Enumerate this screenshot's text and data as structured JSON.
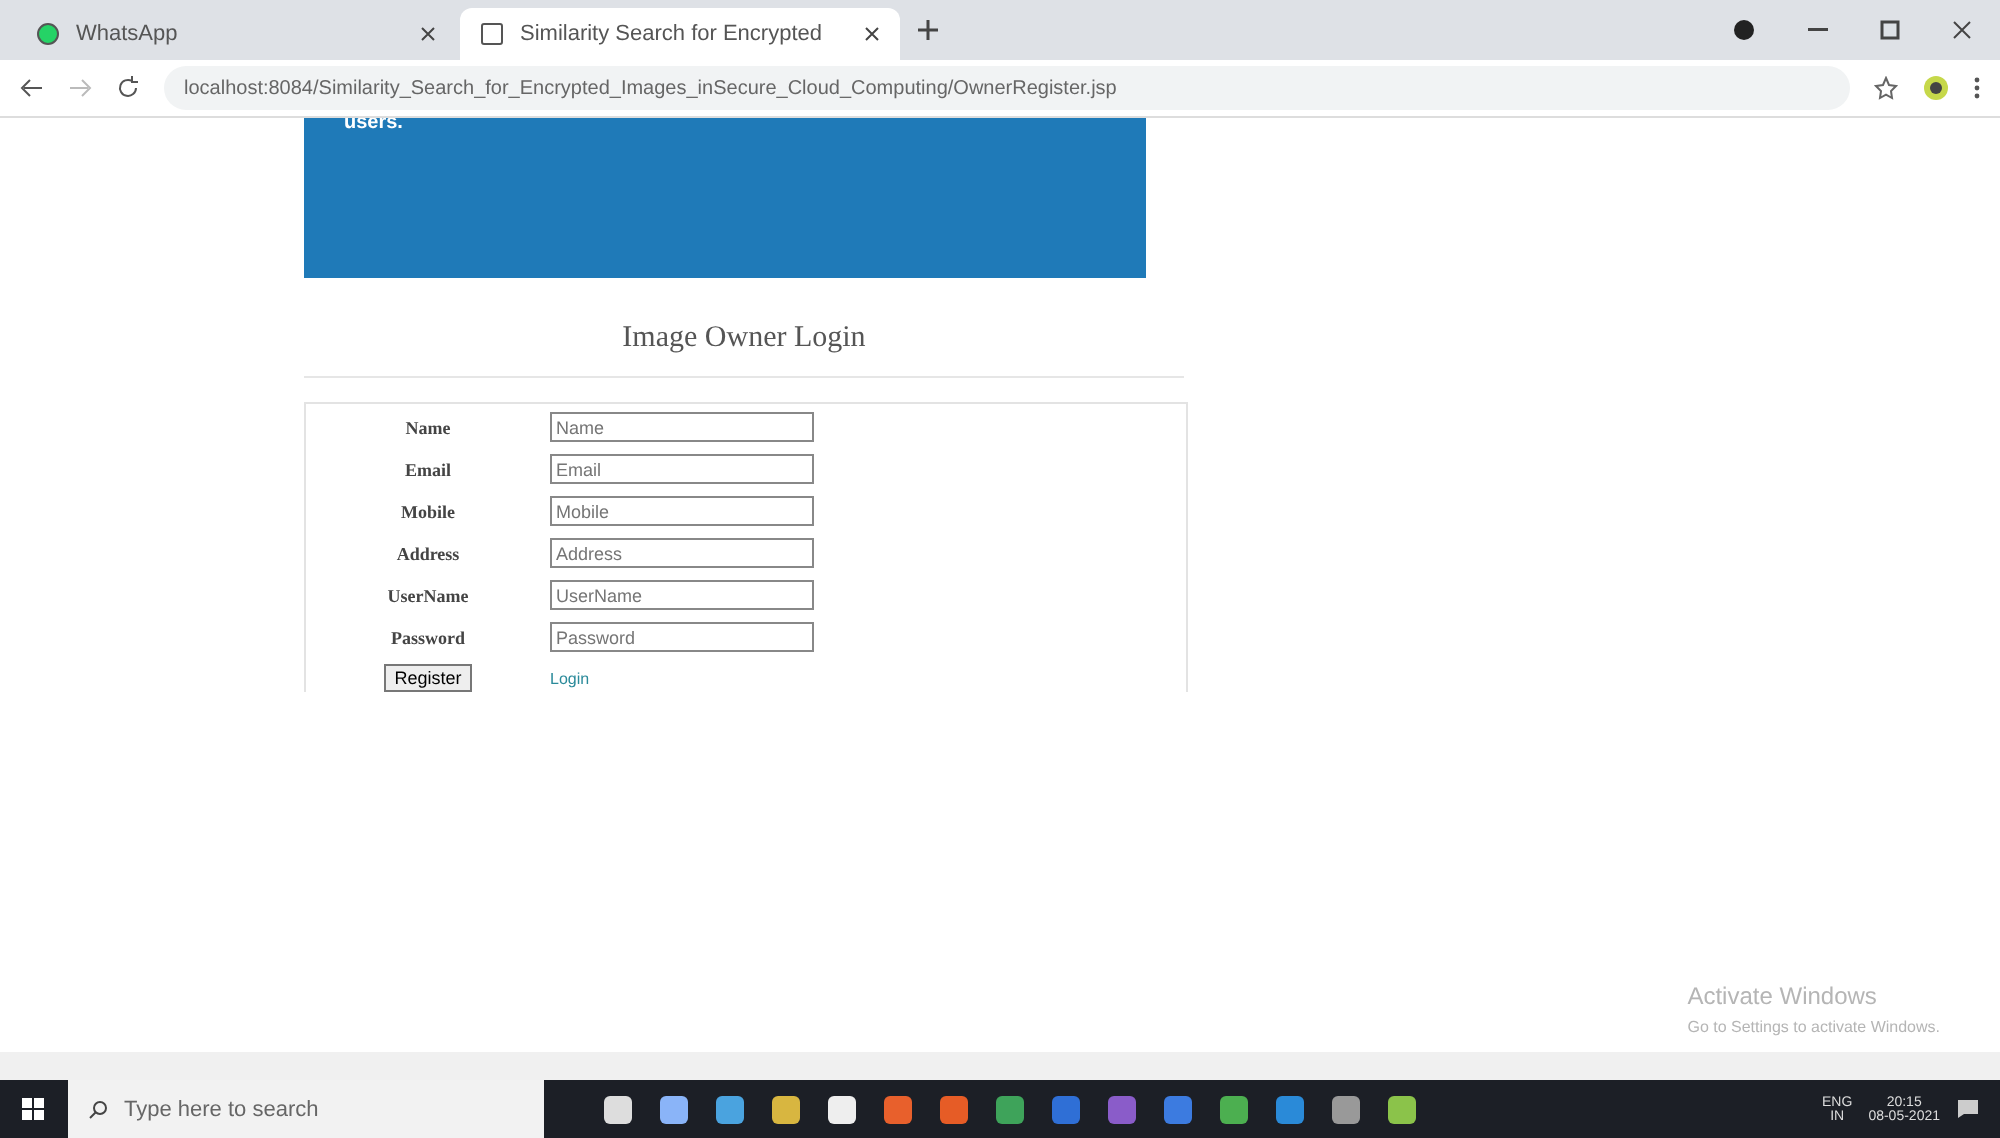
{
  "browser": {
    "tabs": [
      {
        "title": "WhatsApp",
        "selected": false
      },
      {
        "title": "Similarity Search for Encrypted",
        "selected": true
      }
    ],
    "url": "localhost:8084/Similarity_Search_for_Encrypted_Images_inSecure_Cloud_Computing/OwnerRegister.jsp"
  },
  "banner": {
    "text": "users."
  },
  "heading": "Image Owner Login",
  "form": {
    "fields": [
      {
        "label": "Name",
        "placeholder": "Name"
      },
      {
        "label": "Email",
        "placeholder": "Email"
      },
      {
        "label": "Mobile",
        "placeholder": "Mobile"
      },
      {
        "label": "Address",
        "placeholder": "Address"
      },
      {
        "label": "UserName",
        "placeholder": "UserName"
      },
      {
        "label": "Password",
        "placeholder": "Password"
      }
    ],
    "submit": "Register",
    "link": "Login"
  },
  "activation": {
    "title": "Activate Windows",
    "subtitle": "Go to Settings to activate Windows."
  },
  "taskbar": {
    "search_placeholder": "Type here to search",
    "language": [
      "ENG",
      "IN"
    ],
    "time": "20:15",
    "date": "08-05-2021"
  }
}
